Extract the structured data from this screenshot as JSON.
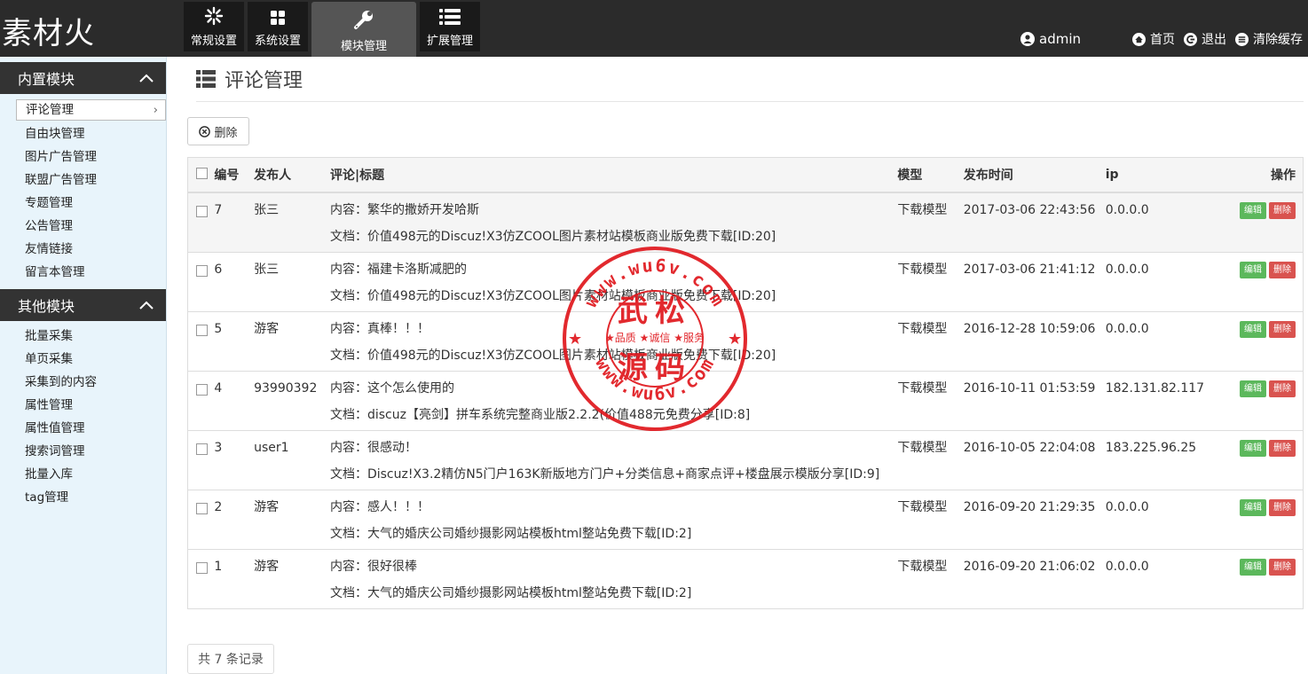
{
  "app": {
    "logo": "素材火"
  },
  "topnav": [
    {
      "label": "常规设置",
      "icon": "snowflake-icon"
    },
    {
      "label": "系统设置",
      "icon": "grid-icon"
    },
    {
      "label": "模块管理",
      "icon": "wrench-icon",
      "active": true
    },
    {
      "label": "扩展管理",
      "icon": "list-icon"
    }
  ],
  "topright": {
    "user": "admin",
    "home": "首页",
    "logout": "退出",
    "clear_cache": "清除缓存"
  },
  "sidebar": {
    "group1": {
      "title": "内置模块",
      "items": [
        "评论管理",
        "自由块管理",
        "图片广告管理",
        "联盟广告管理",
        "专题管理",
        "公告管理",
        "友情链接",
        "留言本管理"
      ]
    },
    "group2": {
      "title": "其他模块",
      "items": [
        "批量采集",
        "单页采集",
        "采集到的内容",
        "属性管理",
        "属性值管理",
        "搜索词管理",
        "批量入库",
        "tag管理"
      ]
    },
    "active_item": "评论管理"
  },
  "main": {
    "title": "评论管理",
    "delete_button": "删除",
    "columns": {
      "id": "编号",
      "author": "发布人",
      "comment": "评论|标题",
      "model": "模型",
      "time": "发布时间",
      "ip": "ip",
      "ops": "操作"
    },
    "rows": [
      {
        "id": "7",
        "author": "张三",
        "content": "内容：繁华的撒娇开发哈斯",
        "doc": "文档：价值498元的Discuz!X3仿ZCOOL图片素材站模板商业版免费下载[ID:20]",
        "model": "下载模型",
        "time": "2017-03-06 22:43:56",
        "ip": "0.0.0.0"
      },
      {
        "id": "6",
        "author": "张三",
        "content": "内容：福建卡洛斯减肥的",
        "doc": "文档：价值498元的Discuz!X3仿ZCOOL图片素材站模板商业版免费下载[ID:20]",
        "model": "下载模型",
        "time": "2017-03-06 21:41:12",
        "ip": "0.0.0.0"
      },
      {
        "id": "5",
        "author": "游客",
        "content": "内容：真棒！！！",
        "doc": "文档：价值498元的Discuz!X3仿ZCOOL图片素材站模板商业版免费下载[ID:20]",
        "model": "下载模型",
        "time": "2016-12-28 10:59:06",
        "ip": "0.0.0.0"
      },
      {
        "id": "4",
        "author": "93990392",
        "content": "内容：这个怎么使用的",
        "doc": "文档：discuz【亮剑】拼车系统完整商业版2.2.2(价值488元免费分享[ID:8]",
        "model": "下载模型",
        "time": "2016-10-11 01:53:59",
        "ip": "182.131.82.117"
      },
      {
        "id": "3",
        "author": "user1",
        "content": "内容：很感动！",
        "doc": "文档：Discuz!X3.2精仿N5门户163K新版地方门户+分类信息+商家点评+楼盘展示模版分享[ID:9]",
        "model": "下载模型",
        "time": "2016-10-05 22:04:08",
        "ip": "183.225.96.25"
      },
      {
        "id": "2",
        "author": "游客",
        "content": "内容：感人！！！",
        "doc": "文档：大气的婚庆公司婚纱摄影网站模板html整站免费下载[ID:2]",
        "model": "下载模型",
        "time": "2016-09-20 21:29:35",
        "ip": "0.0.0.0"
      },
      {
        "id": "1",
        "author": "游客",
        "content": "内容：很好很棒",
        "doc": "文档：大气的婚庆公司婚纱摄影网站模板html整站免费下载[ID:2]",
        "model": "下载模型",
        "time": "2016-09-20 21:06:02",
        "ip": "0.0.0.0"
      }
    ],
    "row_actions": {
      "edit": "编辑",
      "delete": "删除"
    },
    "total": "共 7 条记录"
  },
  "watermark": {
    "url_top": "www.wu6v.com",
    "line1": "武松",
    "motto": "★品质 ★诚信 ★服务",
    "line2": "源码",
    "url_bottom": "www.wu6v.com"
  },
  "colors": {
    "topbar": "#2b2b2b",
    "sidebar_bg": "#e8f4fb",
    "edit": "#5cb85c",
    "delete": "#d9534f",
    "stamp": "#e0191f"
  }
}
